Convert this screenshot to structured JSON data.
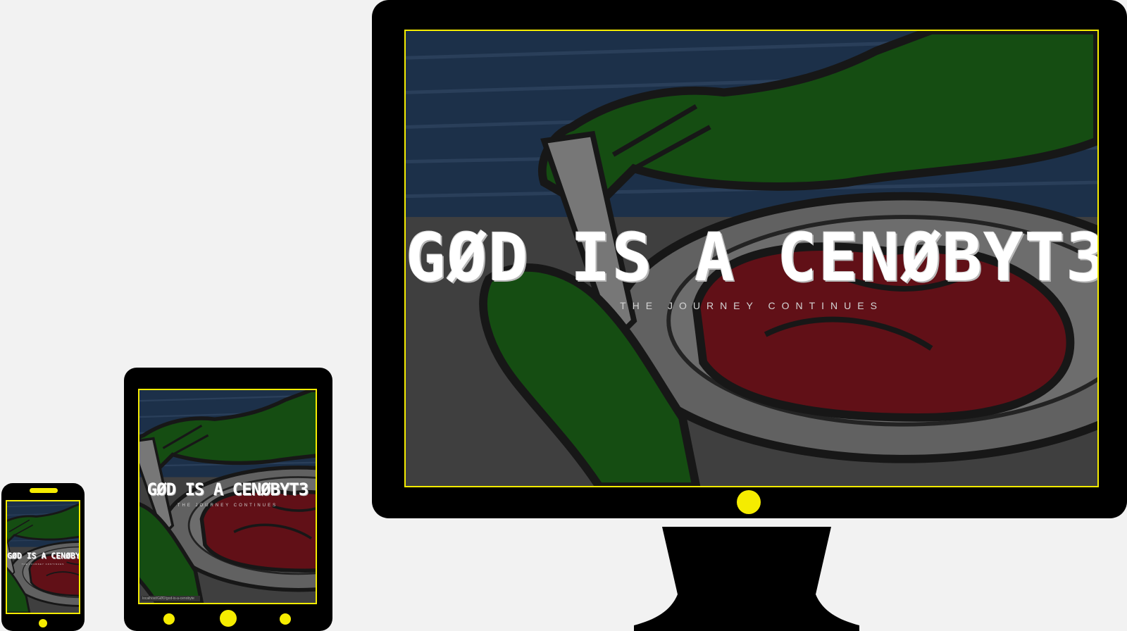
{
  "site": {
    "title": "GØD IS A CENØBYT3",
    "subtitle": "THE JOURNEY CONTINUES"
  },
  "tablet": {
    "url_bar": "localhost/GØD/god-is-a-cenobyte"
  },
  "colors": {
    "accent": "#f5ec00",
    "device_body": "#000000",
    "background": "#f2f2f2",
    "hand_green": "#0e5d0a",
    "meat_red": "#7a0710",
    "sky_blue": "#1d3a5c",
    "plate_gray": "#6e6e6e"
  },
  "devices": [
    "phone",
    "tablet",
    "desktop-monitor"
  ],
  "icons": [
    "home-button-icon",
    "camera-dot-icon",
    "speaker-icon"
  ]
}
